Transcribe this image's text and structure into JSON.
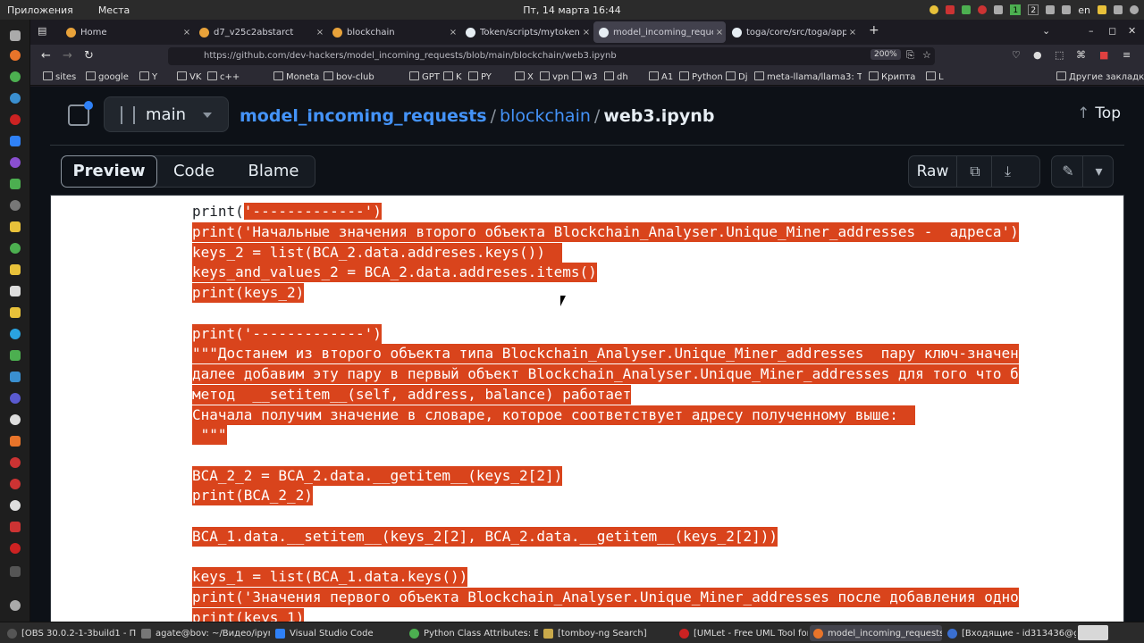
{
  "system_bar": {
    "apps_menu": "Приложения",
    "places_menu": "Места",
    "clock": "Пт, 14 марта  16:44",
    "workspace_1": "1",
    "workspace_2": "2",
    "keyboard_layout": "en"
  },
  "browser": {
    "tabs": [
      {
        "label": "Home",
        "color": "#e8a23a"
      },
      {
        "label": "d7_v25c2abstarct",
        "color": "#e8a23a"
      },
      {
        "label": "blockchain",
        "color": "#e8a23a"
      },
      {
        "label": "Token/scripts/mytoken.p",
        "color": "#e6edf3"
      },
      {
        "label": "model_incoming_request",
        "color": "#e6edf3"
      },
      {
        "label": "toga/core/src/toga/app.p",
        "color": "#e6edf3"
      }
    ],
    "tab_close_glyph": "×",
    "new_tab_glyph": "+",
    "url": "https://github.com/dev-hackers/model_incoming_requests/blob/main/blockchain/web3.ipynb",
    "zoom": "200%",
    "bookmarks": [
      "sites",
      "google",
      "Y",
      "VK",
      "c++",
      "",
      "",
      "Moneta",
      "bov-club",
      "",
      "",
      "GPT",
      "K",
      "PY",
      "",
      "X",
      "vpn",
      "w3",
      "dh",
      "",
      "A1",
      "Python",
      "Dj",
      "meta-llama/llama3: Th...",
      "Крипта",
      "L"
    ],
    "other_bookmarks": "Другие закладки"
  },
  "github": {
    "branch": "main",
    "repo": "model_incoming_requests",
    "directory": "blockchain",
    "file": "web3.ipynb",
    "separator": "/",
    "top_label": "Top",
    "top_arrow": "↑",
    "view_tabs": [
      "Preview",
      "Code",
      "Blame"
    ],
    "raw_label": "Raw",
    "copy_glyph": "⧉",
    "download_glyph": "⤓",
    "edit_glyph": "✎",
    "more_glyph": "▾"
  },
  "code_lines": [
    {
      "text": "print('-------------')",
      "lead": "print(",
      "selected": "'-------------')"
    },
    {
      "text": "print('Начальные значения второго объекта Blockchain_Analyser.Unique_Miner_addresses -  адреса')"
    },
    {
      "text": "keys_2 = list(BCA_2.data.addreses.keys())  "
    },
    {
      "text": "keys_and_values_2 = BCA_2.data.addreses.items()"
    },
    {
      "text": "print(keys_2)"
    },
    {
      "text": ""
    },
    {
      "text": "print('-------------')"
    },
    {
      "text": "\"\"\"Достанем из второго объекта типа Blockchain_Analyser.Unique_Miner_addresses  пару ключ-значен"
    },
    {
      "text": "далее добавим эту пару в первый объект Blockchain_Analyser.Unique_Miner_addresses для того что б"
    },
    {
      "text": "метод  __setitem__(self, address, balance) работает"
    },
    {
      "text": "Сначала получим значение в словаре, которое соответствует адресу полученному выше:  "
    },
    {
      "text": " \"\"\""
    },
    {
      "text": ""
    },
    {
      "text": "BCA_2_2 = BCA_2.data.__getitem__(keys_2[2])"
    },
    {
      "text": "print(BCA_2_2)"
    },
    {
      "text": ""
    },
    {
      "text": "BCA_1.data.__setitem__(keys_2[2], BCA_2.data.__getitem__(keys_2[2]))"
    },
    {
      "text": ""
    },
    {
      "text": "keys_1 = list(BCA_1.data.keys())"
    },
    {
      "text": "print('Значения первого объекта Blockchain_Analyser.Unique_Miner_addresses после добавления одно"
    },
    {
      "text": "print(keys_1)"
    }
  ],
  "taskbar": [
    {
      "label": "[OBS 30.0.2-1-3build1 - Про...",
      "color": "#555555"
    },
    {
      "label": "agate@bov: ~/Видео/ipyn...",
      "color": "#777777"
    },
    {
      "label": "Visual Studio Code",
      "color": "#2f81f7"
    },
    {
      "label": "Python Class Attributes: Ex...",
      "color": "#4caf50"
    },
    {
      "label": "[tomboy-ng Search]",
      "color": "#c9a94a"
    },
    {
      "label": "[UMLet - Free UML Tool for ...",
      "color": "#cc2222"
    },
    {
      "label": "model_incoming_requests...",
      "color": "#e8742a"
    },
    {
      "label": "[Входящие - id313436@g...",
      "color": "#3a6fd0"
    }
  ],
  "colors": {
    "selection": "#d9441c",
    "link": "#4493f8",
    "page_bg": "#0d1117"
  }
}
